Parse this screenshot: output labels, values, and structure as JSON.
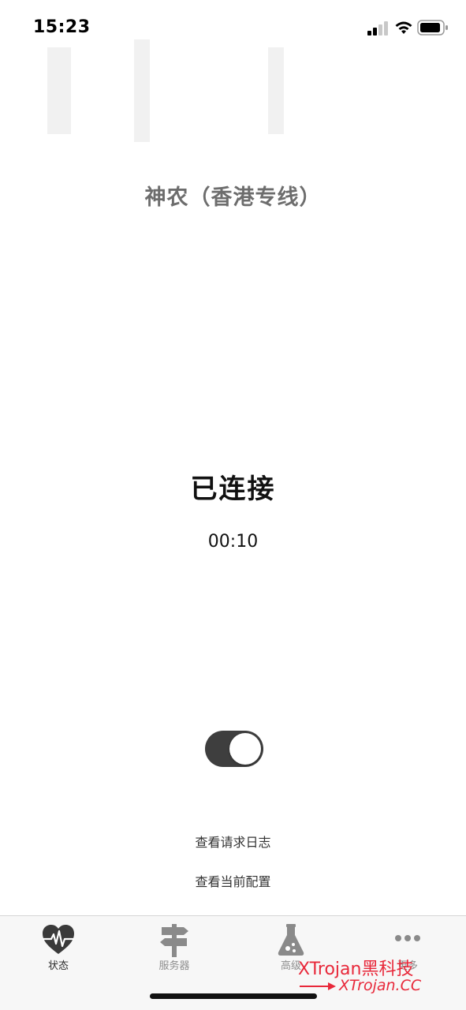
{
  "status_bar": {
    "time": "15:23"
  },
  "server": {
    "name": "神农（香港专线）"
  },
  "connection": {
    "status": "已连接",
    "timer": "00:10",
    "toggle_on": true
  },
  "links": {
    "view_logs": "查看请求日志",
    "view_config": "查看当前配置"
  },
  "tabs": [
    {
      "label": "状态",
      "icon": "heartbeat-icon",
      "active": true
    },
    {
      "label": "服务器",
      "icon": "signpost-icon",
      "active": false
    },
    {
      "label": "高级",
      "icon": "flask-icon",
      "active": false
    },
    {
      "label": "更多",
      "icon": "more-dots-icon",
      "active": false
    }
  ],
  "watermark": {
    "line1": "XTrojan黑科技",
    "line2": "XTrojan.CC"
  },
  "colors": {
    "toggle_on": "#3e3e3e",
    "server_name": "#6d6d6d",
    "watermark": "#e8283a",
    "tab_active": "#2a2a2a",
    "tab_inactive": "#8e8e8e"
  }
}
